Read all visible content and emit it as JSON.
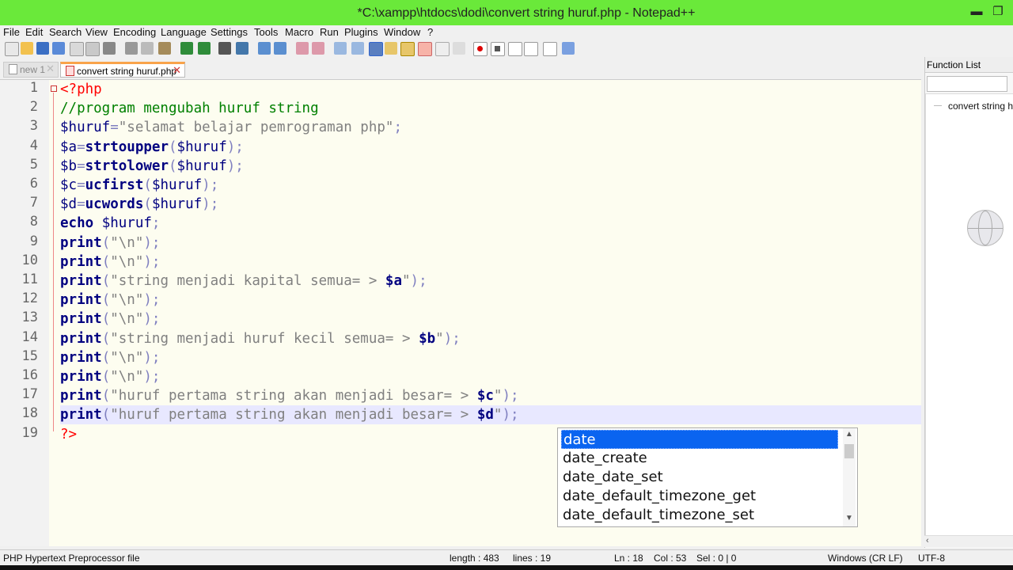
{
  "window": {
    "title": "*C:\\xampp\\htdocs\\dodi\\convert string huruf.php - Notepad++",
    "minimize_glyph": "▬",
    "restore_glyph": "❐"
  },
  "menu": [
    "File",
    "Edit",
    "Search",
    "View",
    "Encoding",
    "Language",
    "Settings",
    "Tools",
    "Macro",
    "Run",
    "Plugins",
    "Window",
    "?"
  ],
  "tabs": [
    {
      "label": "new 1",
      "active": false
    },
    {
      "label": "convert string huruf.php",
      "active": true
    }
  ],
  "tab_close_glyph": "✕",
  "editor": {
    "line_numbers": [
      "1",
      "2",
      "3",
      "4",
      "5",
      "6",
      "7",
      "8",
      "9",
      "10",
      "11",
      "12",
      "13",
      "14",
      "15",
      "16",
      "17",
      "18",
      "19"
    ],
    "current_line": 18,
    "lines": [
      [
        [
          "tag",
          "<?php"
        ]
      ],
      [
        [
          "cm",
          "//program mengubah huruf string"
        ]
      ],
      [
        [
          "var",
          "$huruf"
        ],
        [
          "op",
          "="
        ],
        [
          "st",
          "\"selamat belajar pemrograman php\""
        ],
        [
          "op",
          ";"
        ]
      ],
      [
        [
          "var",
          "$a"
        ],
        [
          "op",
          "="
        ],
        [
          "kw",
          "strtoupper"
        ],
        [
          "op",
          "("
        ],
        [
          "var",
          "$huruf"
        ],
        [
          "op",
          ");"
        ]
      ],
      [
        [
          "var",
          "$b"
        ],
        [
          "op",
          "="
        ],
        [
          "kw",
          "strtolower"
        ],
        [
          "op",
          "("
        ],
        [
          "var",
          "$huruf"
        ],
        [
          "op",
          ");"
        ]
      ],
      [
        [
          "var",
          "$c"
        ],
        [
          "op",
          "="
        ],
        [
          "kw",
          "ucfirst"
        ],
        [
          "op",
          "("
        ],
        [
          "var",
          "$huruf"
        ],
        [
          "op",
          ");"
        ]
      ],
      [
        [
          "var",
          "$d"
        ],
        [
          "op",
          "="
        ],
        [
          "kw",
          "ucwords"
        ],
        [
          "op",
          "("
        ],
        [
          "var",
          "$huruf"
        ],
        [
          "op",
          ");"
        ]
      ],
      [
        [
          "kw",
          "echo"
        ],
        [
          "var",
          " $huruf"
        ],
        [
          "op",
          ";"
        ]
      ],
      [
        [
          "kw",
          "print"
        ],
        [
          "op",
          "("
        ],
        [
          "st",
          "\"\\n\""
        ],
        [
          "op",
          ");"
        ]
      ],
      [
        [
          "kw",
          "print"
        ],
        [
          "op",
          "("
        ],
        [
          "st",
          "\"\\n\""
        ],
        [
          "op",
          ");"
        ]
      ],
      [
        [
          "kw",
          "print"
        ],
        [
          "op",
          "("
        ],
        [
          "st",
          "\"string menjadi kapital semua= > "
        ],
        [
          "bvar",
          "$a"
        ],
        [
          "st",
          "\""
        ],
        [
          "op",
          ");"
        ]
      ],
      [
        [
          "kw",
          "print"
        ],
        [
          "op",
          "("
        ],
        [
          "st",
          "\"\\n\""
        ],
        [
          "op",
          ");"
        ]
      ],
      [
        [
          "kw",
          "print"
        ],
        [
          "op",
          "("
        ],
        [
          "st",
          "\"\\n\""
        ],
        [
          "op",
          ");"
        ]
      ],
      [
        [
          "kw",
          "print"
        ],
        [
          "op",
          "("
        ],
        [
          "st",
          "\"string menjadi huruf kecil semua= > "
        ],
        [
          "bvar",
          "$b"
        ],
        [
          "st",
          "\""
        ],
        [
          "op",
          ");"
        ]
      ],
      [
        [
          "kw",
          "print"
        ],
        [
          "op",
          "("
        ],
        [
          "st",
          "\"\\n\""
        ],
        [
          "op",
          ");"
        ]
      ],
      [
        [
          "kw",
          "print"
        ],
        [
          "op",
          "("
        ],
        [
          "st",
          "\"\\n\""
        ],
        [
          "op",
          ");"
        ]
      ],
      [
        [
          "kw",
          "print"
        ],
        [
          "op",
          "("
        ],
        [
          "st",
          "\"huruf pertama string akan menjadi besar= > "
        ],
        [
          "bvar",
          "$c"
        ],
        [
          "st",
          "\""
        ],
        [
          "op",
          ");"
        ]
      ],
      [
        [
          "kw",
          "print"
        ],
        [
          "op",
          "("
        ],
        [
          "st",
          "\"huruf pertama string akan menjadi besar= > "
        ],
        [
          "bvar",
          "$d"
        ],
        [
          "st",
          "\""
        ],
        [
          "op",
          ");"
        ]
      ],
      [
        [
          "tag",
          "?>"
        ]
      ]
    ]
  },
  "autocomplete": {
    "items": [
      "date",
      "date_create",
      "date_date_set",
      "date_default_timezone_get",
      "date_default_timezone_set"
    ],
    "selected_index": 0
  },
  "function_list": {
    "title": "Function List",
    "node": "convert string huruf.php"
  },
  "status": {
    "filetype": "PHP Hypertext Preprocessor file",
    "length": "length : 483",
    "lines": "lines : 19",
    "ln": "Ln : 18",
    "col": "Col : 53",
    "sel": "Sel : 0 | 0",
    "eol": "Windows (CR LF)",
    "encoding": "UTF-8"
  },
  "colors": {
    "titlebar": "#6ae93a",
    "editor_bg": "#fdfdf0",
    "current_line": "#e8e8ff",
    "selection": "#0a64f0"
  }
}
